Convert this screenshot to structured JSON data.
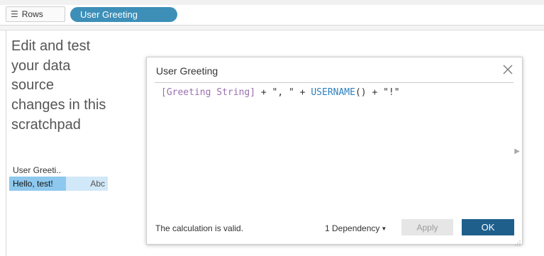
{
  "shelf": {
    "rows_label": "Rows",
    "rows_icon": "rows-list-icon",
    "pill_label": "User Greeting",
    "pill_color": "#3d8fb8"
  },
  "scratchpad": {
    "text": "Edit and test your data source changes in this scratchpad",
    "column_header": "User Greeti..",
    "cell_value": "Hello, test!",
    "cell_type": "Abc",
    "selected_cell_color": "#8ec8ee"
  },
  "dialog": {
    "title": "User Greeting",
    "close_icon": "close-icon",
    "formula": {
      "field": "[Greeting String]",
      "part1": " + \", \" + ",
      "function": "USERNAME",
      "part2": "() + \"!\""
    },
    "status": "The calculation is valid.",
    "dependency": "1 Dependency",
    "apply_label": "Apply",
    "ok_label": "OK",
    "ok_color": "#1e5f8c"
  }
}
